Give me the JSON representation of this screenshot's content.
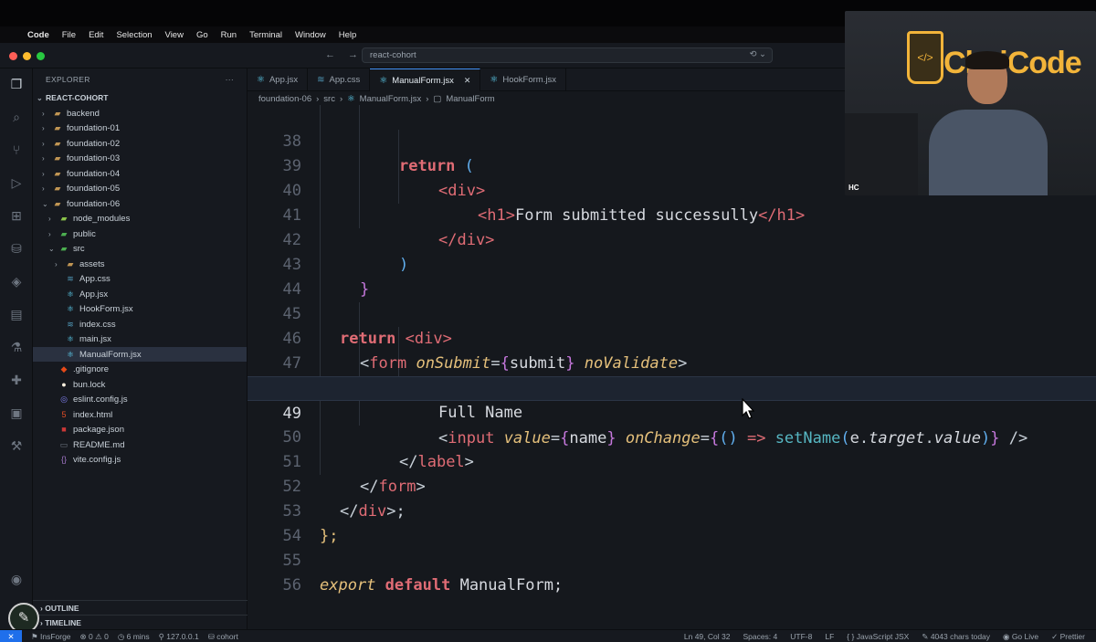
{
  "menubar": {
    "apple_icon": "apple-icon",
    "app_name": "Code",
    "items": [
      "File",
      "Edit",
      "Selection",
      "View",
      "Go",
      "Run",
      "Terminal",
      "Window",
      "Help"
    ]
  },
  "titlebar": {
    "search_text": "react-cohort"
  },
  "explorer": {
    "title": "EXPLORER",
    "more": "···",
    "root": "REACT-COHORT",
    "items": [
      {
        "label": "backend",
        "kind": "folder",
        "depth": 1,
        "expanded": false
      },
      {
        "label": "foundation-01",
        "kind": "folder",
        "depth": 1,
        "expanded": false
      },
      {
        "label": "foundation-02",
        "kind": "folder",
        "depth": 1,
        "expanded": false
      },
      {
        "label": "foundation-03",
        "kind": "folder",
        "depth": 1,
        "expanded": false
      },
      {
        "label": "foundation-04",
        "kind": "folder",
        "depth": 1,
        "expanded": false
      },
      {
        "label": "foundation-05",
        "kind": "folder",
        "depth": 1,
        "expanded": false
      },
      {
        "label": "foundation-06",
        "kind": "folder",
        "depth": 1,
        "expanded": true
      },
      {
        "label": "node_modules",
        "kind": "node",
        "depth": 2,
        "expanded": false
      },
      {
        "label": "public",
        "kind": "public",
        "depth": 2,
        "expanded": false
      },
      {
        "label": "src",
        "kind": "src",
        "depth": 2,
        "expanded": true
      },
      {
        "label": "assets",
        "kind": "folder",
        "depth": 3,
        "expanded": false
      },
      {
        "label": "App.css",
        "kind": "css",
        "depth": 3
      },
      {
        "label": "App.jsx",
        "kind": "react",
        "depth": 3
      },
      {
        "label": "HookForm.jsx",
        "kind": "react",
        "depth": 3
      },
      {
        "label": "index.css",
        "kind": "css",
        "depth": 3
      },
      {
        "label": "main.jsx",
        "kind": "react",
        "depth": 3
      },
      {
        "label": "ManualForm.jsx",
        "kind": "react",
        "depth": 3,
        "selected": true
      },
      {
        "label": ".gitignore",
        "kind": "git",
        "depth": 2
      },
      {
        "label": "bun.lock",
        "kind": "bun",
        "depth": 2
      },
      {
        "label": "eslint.config.js",
        "kind": "eslint",
        "depth": 2
      },
      {
        "label": "index.html",
        "kind": "html",
        "depth": 2
      },
      {
        "label": "package.json",
        "kind": "npm",
        "depth": 2
      },
      {
        "label": "README.md",
        "kind": "md",
        "depth": 2
      },
      {
        "label": "vite.config.js",
        "kind": "js",
        "depth": 2
      }
    ],
    "outline": "OUTLINE",
    "timeline": "TIMELINE"
  },
  "tabs": [
    {
      "label": "App.jsx",
      "kind": "react",
      "active": false
    },
    {
      "label": "App.css",
      "kind": "css",
      "active": false
    },
    {
      "label": "ManualForm.jsx",
      "kind": "react",
      "active": true
    },
    {
      "label": "HookForm.jsx",
      "kind": "react",
      "active": false
    }
  ],
  "breadcrumb": [
    "foundation-06",
    "src",
    "ManualForm.jsx",
    "ManualForm"
  ],
  "code": {
    "line_numbers": [
      "38",
      "39",
      "40",
      "41",
      "42",
      "43",
      "44",
      "45",
      "46",
      "47",
      "48",
      "49",
      "50",
      "51",
      "52",
      "53",
      "54",
      "55",
      "56"
    ],
    "current_line": "49",
    "l38": {
      "kw": "return",
      "rest": " ("
    },
    "l39": {
      "text": "<div>"
    },
    "l40": {
      "open": "<h1>",
      "content": "Form submitted successully",
      "close": "</h1>"
    },
    "l41": {
      "text": "</div>"
    },
    "l42": {
      "text": ")"
    },
    "l43": {
      "text": "}"
    },
    "l45": {
      "kw": "return",
      "open": "<div>"
    },
    "l46": {
      "tag": "form",
      "attr1": "onSubmit",
      "val1": "submit",
      "attr2": "noValidate"
    },
    "l47": {
      "tag": "label"
    },
    "l48": {
      "text": "Full Name"
    },
    "l49": {
      "tag": "input",
      "attr1": "value",
      "val1": "name",
      "attr2": "onChange",
      "arrow": "=>",
      "fn": "setName",
      "obj": "e",
      "p1": "target",
      "p2": "value"
    },
    "l50": {
      "text": "label"
    },
    "l51": {
      "text": "form"
    },
    "l52": {
      "text": "div"
    },
    "l53": {
      "text": "};"
    },
    "l55": {
      "export": "export",
      "default": "default",
      "name": "ManualForm;"
    }
  },
  "webcam": {
    "brand_text": "ChaiCode",
    "cup_symbol": "</>",
    "badge": "HC"
  },
  "statusbar": {
    "remote_icon": "remote-icon",
    "branch": "InsForge",
    "errors": "0",
    "warnings": "0",
    "time": "6 mins",
    "host": "127.0.0.1",
    "cohort": "cohort",
    "position": "Ln 49, Col 32",
    "spaces": "Spaces: 4",
    "encoding": "UTF-8",
    "eol": "LF",
    "language": "JavaScript JSX",
    "chars": "4043 chars today",
    "golive": "Go Live",
    "prettier": "Prettier"
  }
}
